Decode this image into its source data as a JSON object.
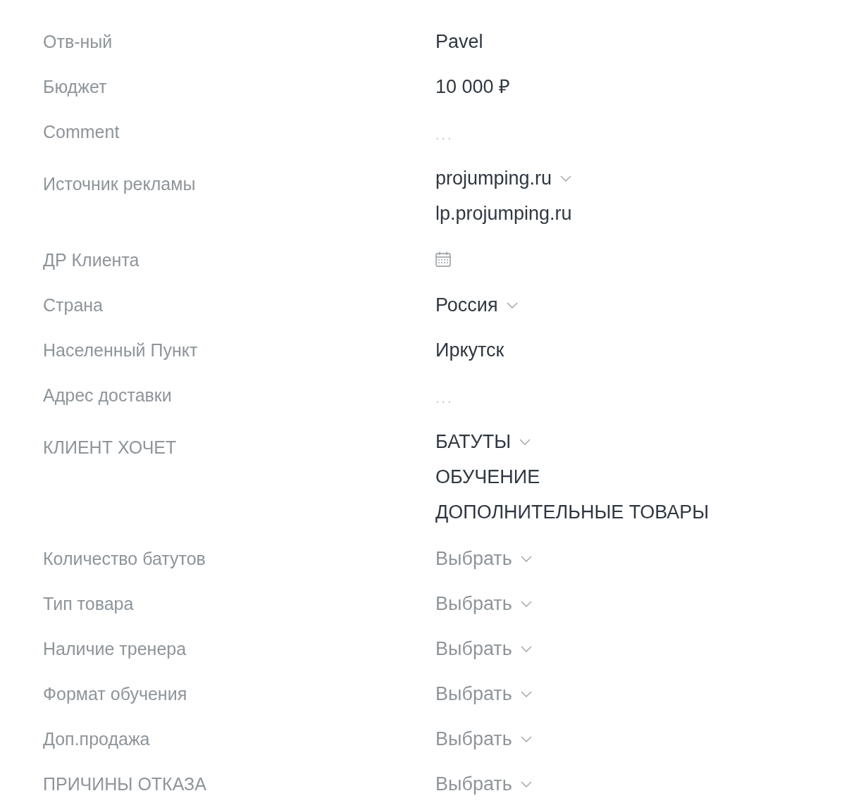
{
  "fields": [
    {
      "label": "Отв-ный",
      "kind": "text",
      "value": "Pavel"
    },
    {
      "label": "Бюджет",
      "kind": "text",
      "value": "10 000 ₽"
    },
    {
      "label": "Comment",
      "kind": "empty",
      "placeholder": "..."
    },
    {
      "label": "Источник рекламы",
      "kind": "multiselect",
      "values": [
        "projumping.ru",
        "lp.projumping.ru"
      ]
    },
    {
      "label": "ДР Клиента",
      "kind": "date"
    },
    {
      "label": "Страна",
      "kind": "select",
      "value": "Россия"
    },
    {
      "label": "Населенный Пункт",
      "kind": "text",
      "value": "Иркутск"
    },
    {
      "label": "Адрес доставки",
      "kind": "empty",
      "placeholder": "..."
    },
    {
      "label": "КЛИЕНТ ХОЧЕТ",
      "kind": "multiselect",
      "values": [
        "БАТУТЫ",
        "ОБУЧЕНИЕ",
        "ДОПОЛНИТЕЛЬНЫЕ ТОВАРЫ"
      ]
    },
    {
      "label": "Количество батутов",
      "kind": "select",
      "placeholder": "Выбрать"
    },
    {
      "label": "Тип товара",
      "kind": "select",
      "placeholder": "Выбрать"
    },
    {
      "label": "Наличие тренера",
      "kind": "select",
      "placeholder": "Выбрать"
    },
    {
      "label": "Формат обучения",
      "kind": "select",
      "placeholder": "Выбрать"
    },
    {
      "label": "Доп.продажа",
      "kind": "select",
      "placeholder": "Выбрать"
    },
    {
      "label": "ПРИЧИНЫ ОТКАЗА",
      "kind": "select",
      "placeholder": "Выбрать"
    }
  ]
}
